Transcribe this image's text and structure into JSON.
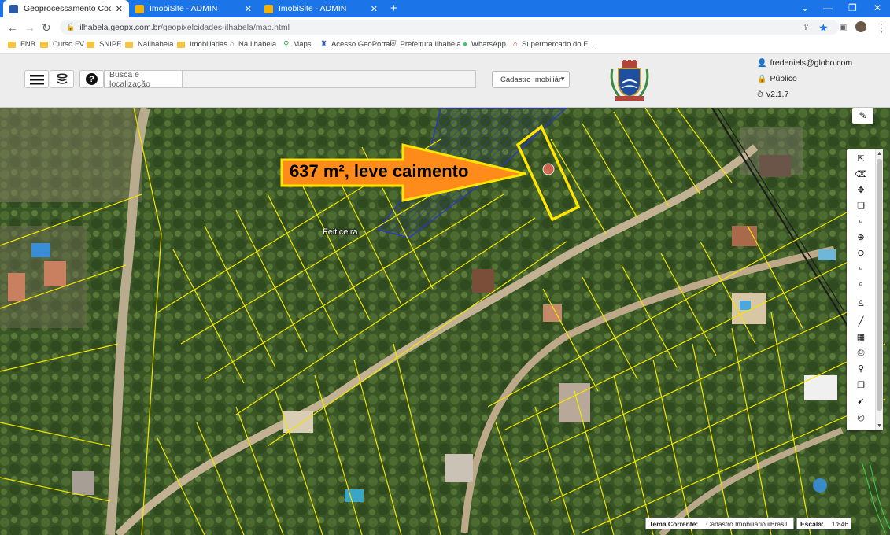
{
  "browser": {
    "tabs": [
      {
        "title": "Geoprocessamento Coorporativo",
        "active": true,
        "favicon_color": "#2d5aa8"
      },
      {
        "title": "ImobiSite - ADMIN",
        "active": false,
        "favicon_color": "#f2b400"
      },
      {
        "title": "ImobiSite - ADMIN",
        "active": false,
        "favicon_color": "#f2b400"
      }
    ],
    "url_host": "ilhabela.geopx.com.br",
    "url_path": "/geopixelcidades-ilhabela/map.html",
    "bookmarks": [
      {
        "label": "FNB",
        "icon": "folder-icon"
      },
      {
        "label": "Curso FV",
        "icon": "folder-icon"
      },
      {
        "label": "SNIPE",
        "icon": "folder-icon"
      },
      {
        "label": "NaIlhabela",
        "icon": "folder-icon"
      },
      {
        "label": "Imobiliarias",
        "icon": "folder-icon"
      },
      {
        "label": "Na Ilhabela",
        "icon": "home-icon"
      },
      {
        "label": "Maps",
        "icon": "map-pin-icon"
      },
      {
        "label": "Acesso GeoPortal",
        "icon": "geoportal-icon"
      },
      {
        "label": "Prefeitura Ilhabela",
        "icon": "crest-icon"
      },
      {
        "label": "WhatsApp",
        "icon": "whatsapp-icon"
      },
      {
        "label": "Supermercado do F...",
        "icon": "store-icon"
      }
    ],
    "accent_color": "#1b74e8"
  },
  "app": {
    "search_label": "Busca e localização",
    "search_placeholder": "",
    "layer_select": "Cadastro Imobiliár",
    "user_email": "fredeniels@globo.com",
    "access": "Público",
    "version": "v2.1.7"
  },
  "map": {
    "place_label": "Feiticeira",
    "annotation": "637 m², leve caimento",
    "tools": [
      "select-arrow-icon",
      "eraser-icon",
      "full-extent-icon",
      "layers-query-icon",
      "zoom-box-icon",
      "zoom-in-icon",
      "zoom-out-icon",
      "zoom-previous-icon",
      "zoom-next-icon",
      "street-view-icon",
      "measure-line-icon",
      "measure-area-icon",
      "print-icon",
      "place-marker-icon",
      "copy-icon",
      "pin-icon",
      "help-icon"
    ],
    "status": {
      "theme_label": "Tema Corrente:",
      "theme_value": "Cadastro Imobiliário iiBrasil",
      "scale_label": "Escala:",
      "scale_value": "1/846"
    },
    "lot_line_color": "#f2e600",
    "callout_fill": "#ff8c1a",
    "callout_stroke": "#ffe600"
  }
}
